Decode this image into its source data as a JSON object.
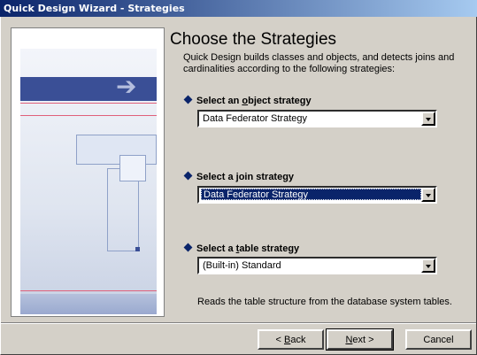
{
  "window": {
    "title": "Quick Design Wizard - Strategies"
  },
  "page": {
    "heading": "Choose the Strategies",
    "description": "Quick Design builds classes and objects, and detects joins and cardinalities according to the following strategies:"
  },
  "object_strategy": {
    "label_pre": "Select an ",
    "label_accel": "o",
    "label_post": "bject strategy",
    "value": "Data Federator Strategy"
  },
  "join_strategy": {
    "label_pre": "Select a ",
    "label_accel": "j",
    "label_post": "oin strategy",
    "value": "Data Federator Strategy"
  },
  "table_strategy": {
    "label_pre": "Select a ",
    "label_accel": "t",
    "label_post": "able strategy",
    "value": "(Built-in) Standard",
    "note": "Reads the table structure from the database system tables."
  },
  "buttons": {
    "back_accel": "B",
    "back_rest": "ack",
    "next_accel": "N",
    "next_rest": "ext >",
    "cancel": "Cancel"
  },
  "icons": {
    "diamond": "diamond-bullet-icon",
    "arrow": "arrow-right-icon",
    "dropdown": "chevron-down-icon"
  },
  "colors": {
    "title_bar": "#0a246a",
    "selection": "#0a246a",
    "face": "#d4d0c8"
  }
}
